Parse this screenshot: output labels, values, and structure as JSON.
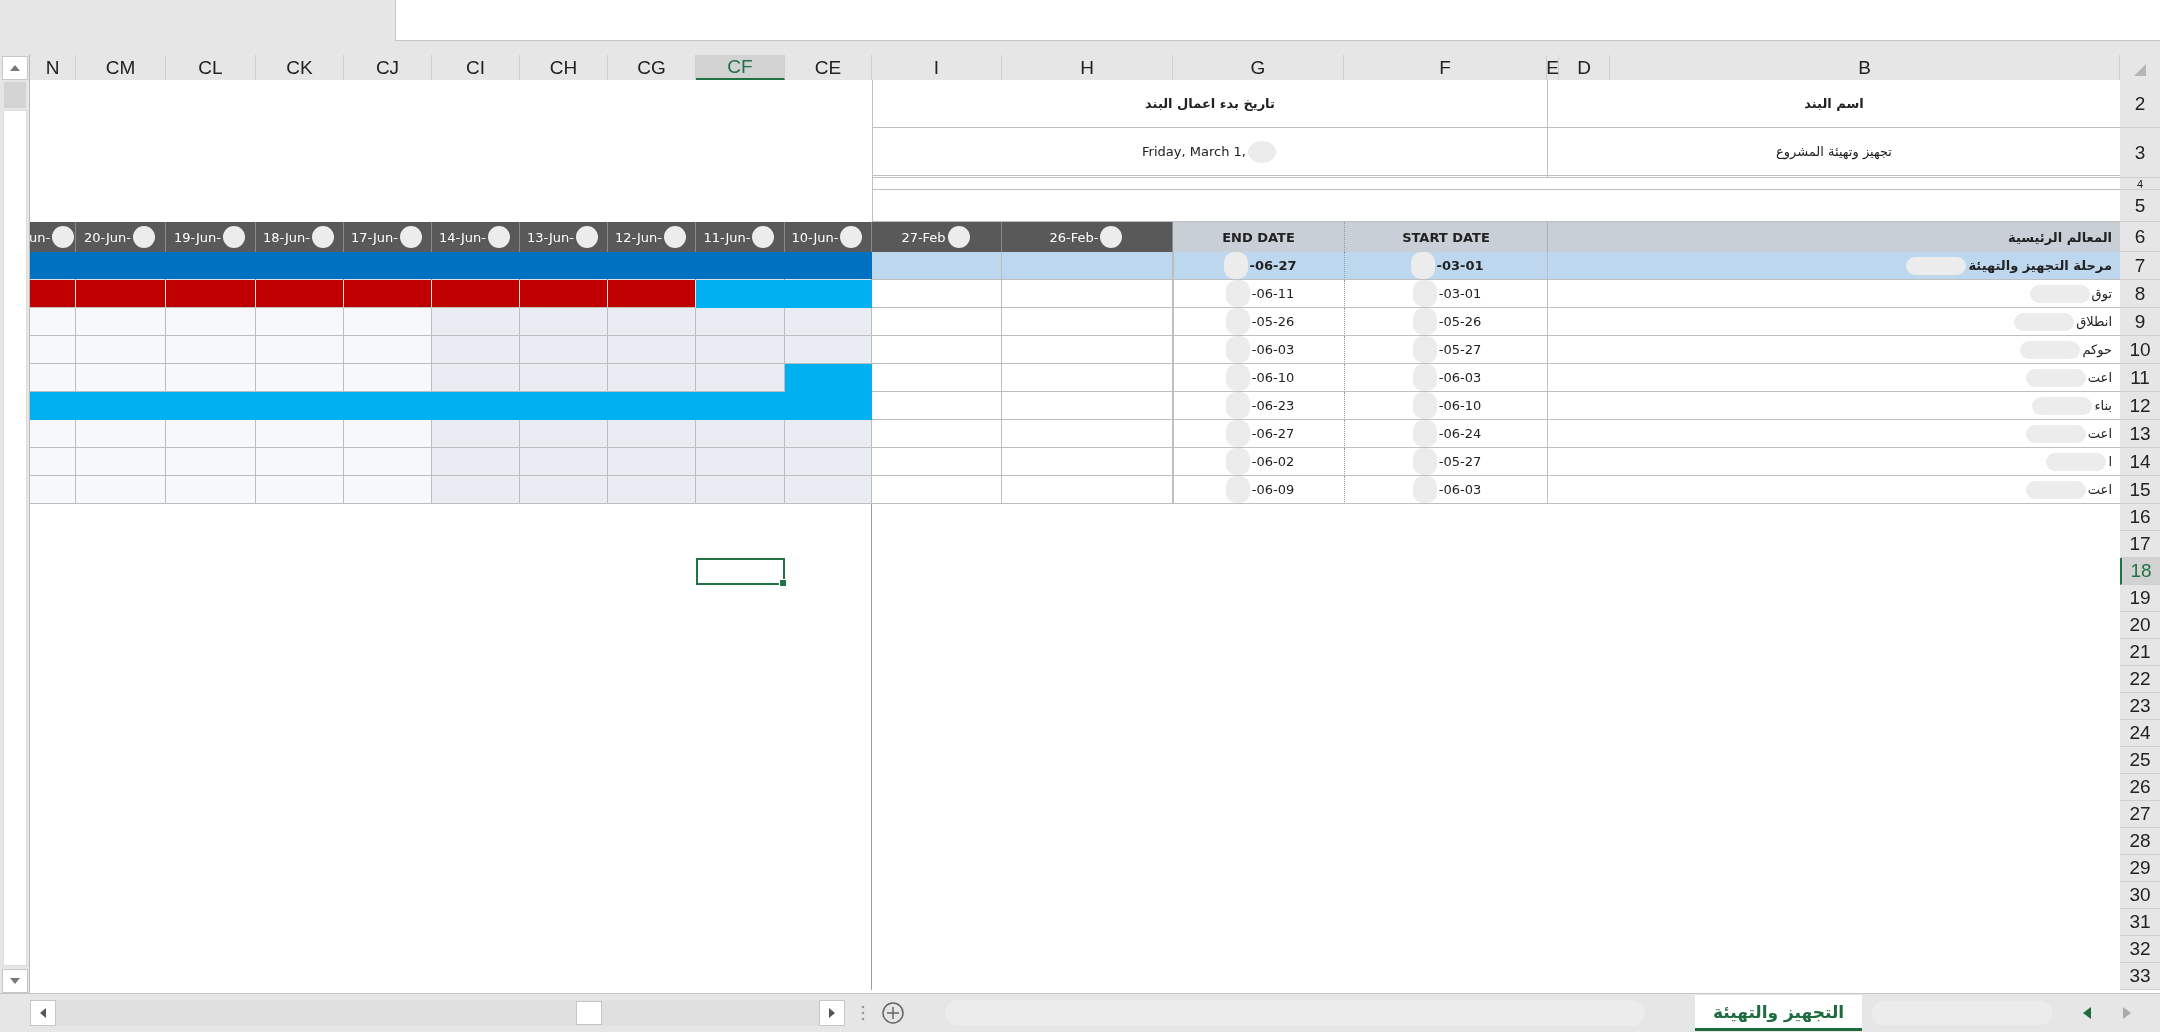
{
  "columns": [
    {
      "label": "N",
      "selected": false
    },
    {
      "label": "CM",
      "selected": false
    },
    {
      "label": "CL",
      "selected": false
    },
    {
      "label": "CK",
      "selected": false
    },
    {
      "label": "CJ",
      "selected": false
    },
    {
      "label": "CI",
      "selected": false
    },
    {
      "label": "CH",
      "selected": false
    },
    {
      "label": "CG",
      "selected": false
    },
    {
      "label": "CF",
      "selected": true
    },
    {
      "label": "CE",
      "selected": false
    },
    {
      "label": "I",
      "selected": false
    },
    {
      "label": "H",
      "selected": false
    },
    {
      "label": "G",
      "selected": false
    },
    {
      "label": "F",
      "selected": false
    },
    {
      "label": "E",
      "selected": false
    },
    {
      "label": "D",
      "selected": false
    },
    {
      "label": "B",
      "selected": false
    }
  ],
  "row_numbers": [
    {
      "label": "2",
      "selected": false
    },
    {
      "label": "3",
      "selected": false
    },
    {
      "label": "4",
      "selected": false
    },
    {
      "label": "5",
      "selected": false
    },
    {
      "label": "6",
      "selected": false
    },
    {
      "label": "7",
      "selected": false
    },
    {
      "label": "8",
      "selected": false
    },
    {
      "label": "9",
      "selected": false
    },
    {
      "label": "10",
      "selected": false
    },
    {
      "label": "11",
      "selected": false
    },
    {
      "label": "12",
      "selected": false
    },
    {
      "label": "13",
      "selected": false
    },
    {
      "label": "14",
      "selected": false
    },
    {
      "label": "15",
      "selected": false
    },
    {
      "label": "16",
      "selected": false
    },
    {
      "label": "17",
      "selected": false
    },
    {
      "label": "18",
      "selected": true
    },
    {
      "label": "19",
      "selected": false
    },
    {
      "label": "20",
      "selected": false
    },
    {
      "label": "21",
      "selected": false
    },
    {
      "label": "22",
      "selected": false
    },
    {
      "label": "23",
      "selected": false
    },
    {
      "label": "24",
      "selected": false
    },
    {
      "label": "25",
      "selected": false
    },
    {
      "label": "26",
      "selected": false
    },
    {
      "label": "27",
      "selected": false
    },
    {
      "label": "28",
      "selected": false
    },
    {
      "label": "29",
      "selected": false
    },
    {
      "label": "30",
      "selected": false
    },
    {
      "label": "31",
      "selected": false
    },
    {
      "label": "32",
      "selected": false
    },
    {
      "label": "33",
      "selected": false
    }
  ],
  "project": {
    "name_label": "اسم البند",
    "start_label": "تاريخ بدء اعمال البند",
    "name": "تجهيز وتهيئة المشروع",
    "start": "Friday, March 1,"
  },
  "table": {
    "task_header": "المعالم الرئيسية",
    "start_header": "START DATE",
    "end_header": "END DATE",
    "timeline": [
      {
        "label": "un-",
        "color": "#f7f8fa"
      },
      {
        "label": "20-Jun-",
        "color": "#f7f8fa"
      },
      {
        "label": "19-Jun-",
        "color": "#f7f8fa"
      },
      {
        "label": "18-Jun-",
        "color": "#f7f8fa"
      },
      {
        "label": "17-Jun-",
        "color": "#f7f8fa"
      },
      {
        "label": "14-Jun-",
        "color": "#e9ecf3"
      },
      {
        "label": "13-Jun-",
        "color": "#e9ecf3"
      },
      {
        "label": "12-Jun-",
        "color": "#e9ecf3"
      },
      {
        "label": "11-Jun-",
        "color": "#e9ecf3"
      },
      {
        "label": "10-Jun-",
        "color": "#e9ecf3"
      },
      {
        "label": "27-Feb",
        "color": "#ffffff"
      },
      {
        "label": "26-Feb-",
        "color": "#ffffff"
      }
    ],
    "rows": [
      {
        "task": "مرحلة التجهيز والتهيئة",
        "start": "-03-01",
        "end": "-06-27",
        "phase": true,
        "cells": [
          {
            "kind": "phase"
          },
          {
            "kind": "phase"
          },
          {
            "kind": "phase"
          },
          {
            "kind": "phase"
          },
          {
            "kind": "phase"
          },
          {
            "kind": "phase"
          },
          {
            "kind": "phase"
          },
          {
            "kind": "phase"
          },
          {
            "kind": "phase"
          },
          {
            "kind": "phase"
          },
          {
            "kind": "none"
          },
          {
            "kind": "none"
          }
        ]
      },
      {
        "task": "توق",
        "start": "-03-01",
        "end": "-06-11",
        "phase": false,
        "cells": [
          {
            "kind": "late"
          },
          {
            "kind": "late"
          },
          {
            "kind": "late"
          },
          {
            "kind": "late"
          },
          {
            "kind": "late"
          },
          {
            "kind": "late"
          },
          {
            "kind": "late"
          },
          {
            "kind": "late"
          },
          {
            "kind": "current"
          },
          {
            "kind": "current"
          },
          {
            "kind": "none"
          },
          {
            "kind": "none"
          }
        ]
      },
      {
        "task": "انطلاق",
        "start": "-05-26",
        "end": "-05-26",
        "phase": false,
        "cells": [
          {
            "kind": "none"
          },
          {
            "kind": "none"
          },
          {
            "kind": "none"
          },
          {
            "kind": "none"
          },
          {
            "kind": "none"
          },
          {
            "kind": "none"
          },
          {
            "kind": "none"
          },
          {
            "kind": "none"
          },
          {
            "kind": "none"
          },
          {
            "kind": "none"
          },
          {
            "kind": "none"
          },
          {
            "kind": "none"
          }
        ]
      },
      {
        "task": "حوكم",
        "start": "-05-27",
        "end": "-06-03",
        "phase": false,
        "cells": [
          {
            "kind": "none"
          },
          {
            "kind": "none"
          },
          {
            "kind": "none"
          },
          {
            "kind": "none"
          },
          {
            "kind": "none"
          },
          {
            "kind": "none"
          },
          {
            "kind": "none"
          },
          {
            "kind": "none"
          },
          {
            "kind": "none"
          },
          {
            "kind": "none"
          },
          {
            "kind": "none"
          },
          {
            "kind": "none"
          }
        ]
      },
      {
        "task": "اعت",
        "start": "-06-03",
        "end": "-06-10",
        "phase": false,
        "cells": [
          {
            "kind": "none"
          },
          {
            "kind": "none"
          },
          {
            "kind": "none"
          },
          {
            "kind": "none"
          },
          {
            "kind": "none"
          },
          {
            "kind": "none"
          },
          {
            "kind": "none"
          },
          {
            "kind": "none"
          },
          {
            "kind": "none"
          },
          {
            "kind": "current"
          },
          {
            "kind": "none"
          },
          {
            "kind": "none"
          }
        ]
      },
      {
        "task": "بناء",
        "start": "-06-10",
        "end": "-06-23",
        "phase": false,
        "cells": [
          {
            "kind": "current"
          },
          {
            "kind": "current"
          },
          {
            "kind": "current"
          },
          {
            "kind": "current"
          },
          {
            "kind": "current"
          },
          {
            "kind": "current"
          },
          {
            "kind": "current"
          },
          {
            "kind": "current"
          },
          {
            "kind": "current"
          },
          {
            "kind": "current"
          },
          {
            "kind": "none"
          },
          {
            "kind": "none"
          }
        ]
      },
      {
        "task": "اعت",
        "start": "-06-24",
        "end": "-06-27",
        "phase": false,
        "cells": [
          {
            "kind": "none"
          },
          {
            "kind": "none"
          },
          {
            "kind": "none"
          },
          {
            "kind": "none"
          },
          {
            "kind": "none"
          },
          {
            "kind": "none"
          },
          {
            "kind": "none"
          },
          {
            "kind": "none"
          },
          {
            "kind": "none"
          },
          {
            "kind": "none"
          },
          {
            "kind": "none"
          },
          {
            "kind": "none"
          }
        ]
      },
      {
        "task": "ا",
        "start": "-05-27",
        "end": "-06-02",
        "phase": false,
        "cells": [
          {
            "kind": "none"
          },
          {
            "kind": "none"
          },
          {
            "kind": "none"
          },
          {
            "kind": "none"
          },
          {
            "kind": "none"
          },
          {
            "kind": "none"
          },
          {
            "kind": "none"
          },
          {
            "kind": "none"
          },
          {
            "kind": "none"
          },
          {
            "kind": "none"
          },
          {
            "kind": "none"
          },
          {
            "kind": "none"
          }
        ]
      },
      {
        "task": "اعت",
        "start": "-06-03",
        "end": "-06-09",
        "phase": false,
        "cells": [
          {
            "kind": "none"
          },
          {
            "kind": "none"
          },
          {
            "kind": "none"
          },
          {
            "kind": "none"
          },
          {
            "kind": "none"
          },
          {
            "kind": "none"
          },
          {
            "kind": "none"
          },
          {
            "kind": "none"
          },
          {
            "kind": "none"
          },
          {
            "kind": "none"
          },
          {
            "kind": "none"
          },
          {
            "kind": "none"
          }
        ]
      }
    ]
  },
  "sheet_tabs": [
    {
      "label": "التجهيز والتهيئة",
      "selected": true
    }
  ]
}
